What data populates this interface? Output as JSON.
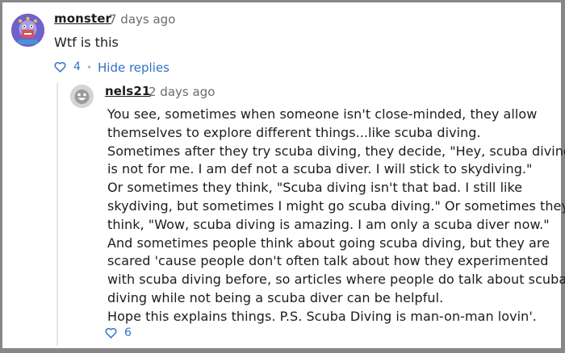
{
  "comment": {
    "author": "monster",
    "time": "7 days ago",
    "text": "Wtf is this",
    "likes": "4",
    "hide_replies_label": "Hide replies",
    "avatar_icon": "monster-avatar-icon"
  },
  "reply": {
    "author": "nels21",
    "time": "2 days ago",
    "avatar_icon": "face-avatar-icon",
    "lines": [
      "You see, sometimes when someone isn't close-minded, they allow",
      "themselves to explore different things...like scuba diving.",
      "Sometimes after they try scuba diving, they decide, \"Hey, scuba diving",
      "is not for me. I am def not a scuba diver. I will stick to skydiving.\"",
      "Or sometimes they think, \"Scuba diving isn't that bad. I still like",
      "skydiving, but sometimes I might go scuba diving.\" Or sometimes they",
      "think, \"Wow, scuba diving is amazing. I am only a scuba diver now.\"",
      "And sometimes people think about going scuba diving, but they are",
      "scared 'cause people don't often talk about how they experimented",
      "with scuba diving before, so articles where people do talk about scuba",
      "diving while not being a scuba diver can be helpful.",
      "Hope this explains things. P.S. Scuba Diving is man-on-man lovin'."
    ],
    "likes": "6"
  },
  "colors": {
    "link": "#2f73c7",
    "text": "#1c1c1c",
    "muted": "#6b6b6b"
  }
}
